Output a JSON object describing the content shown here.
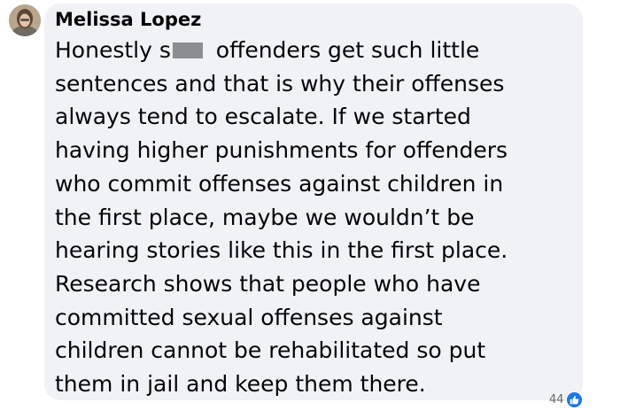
{
  "comment": {
    "author": "Melissa Lopez",
    "lines": [
      {
        "before": "Honestly s",
        "after": " offenders get such little"
      },
      "sentences and that is why their offenses",
      "always tend to escalate. If we started",
      "having higher punishments for offenders",
      "who commit offenses against children in",
      "the first place, maybe we wouldn’t be",
      "hearing stories like this in the first place.",
      "Research shows that people who have",
      "committed sexual offenses against",
      "children cannot be rehabilitated so put",
      "them in jail and keep them there."
    ],
    "reaction_count": "44",
    "reaction_icon": "like-icon"
  },
  "colors": {
    "bubble": "#f0f2f5",
    "text": "#050505",
    "like": "#1877f2",
    "muted": "#65676b"
  }
}
